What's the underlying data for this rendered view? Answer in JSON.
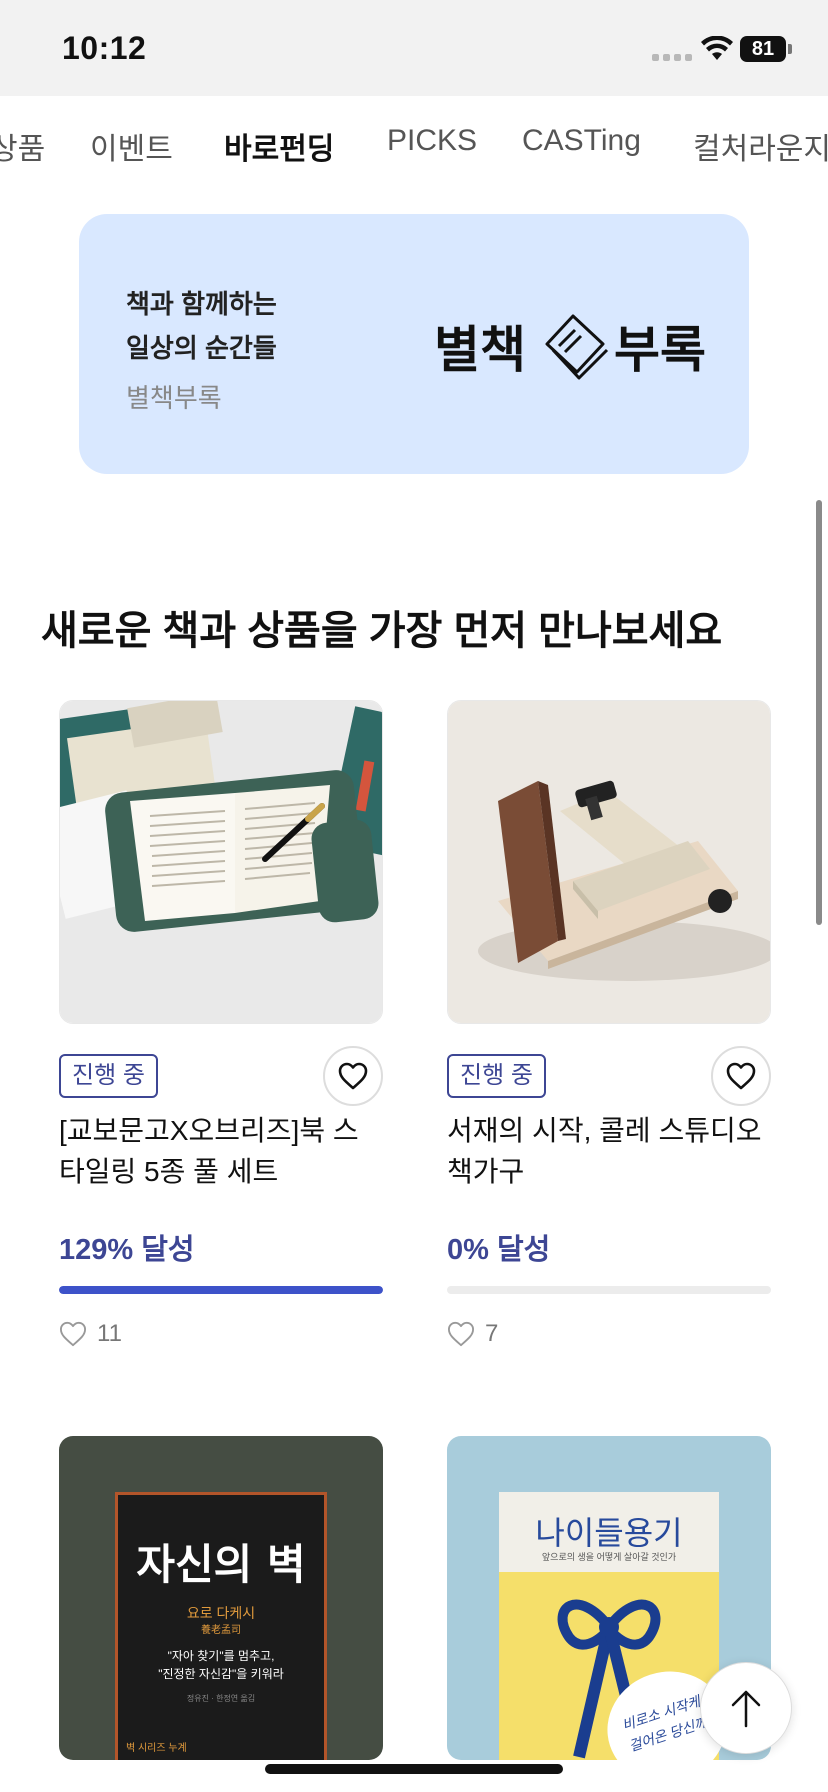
{
  "status_bar": {
    "time": "10:12",
    "battery": "81"
  },
  "tabs": [
    {
      "label": "상품"
    },
    {
      "label": "이벤트"
    },
    {
      "label": "바로펀딩"
    },
    {
      "label": "PICKS"
    },
    {
      "label": "CASTing"
    },
    {
      "label": "컬처라운지"
    }
  ],
  "banner": {
    "line1": "책과 함께하는",
    "line2": "일상의 순간들",
    "line3": "별책부록",
    "logo_a": "별책",
    "logo_b": "부록"
  },
  "section": {
    "title": "새로운 책과 상품을 가장 먼저 만나보세요"
  },
  "products": [
    {
      "badge": "진행 중",
      "title": "[교보문고X오브리즈]북 스타일링 5종 풀 세트",
      "achieve": "129% 달성",
      "progress_fraction": 1.0,
      "likes": "11"
    },
    {
      "badge": "진행 중",
      "title": "서재의 시작, 콜레 스튜디오 책가구",
      "achieve": "0% 달성",
      "progress_fraction": 0.0,
      "likes": "7"
    }
  ],
  "books": [
    {
      "title": "자신의 벽",
      "author": "요로 다케시",
      "author_sub": "養老孟司",
      "tagline1": "\"자아 찾기\"를 멈추고,",
      "tagline2": "\"진정한 자신감\"을 키워라",
      "translator": "정유진 · 한정연 옮김",
      "series": "벽 시리즈 누계"
    },
    {
      "title": "나이들용기",
      "subtitle": "앞으로의 생을 어떻게 살아갈 것인가",
      "tag1": "비로소 시작케",
      "tag2": "걸어온 당신께"
    }
  ],
  "colors": {
    "accent": "#3d4694",
    "progress": "#3d52c9",
    "banner_bg": "#d9e8ff"
  },
  "icons": [
    "wifi-icon",
    "heart-icon",
    "heart-outline-icon",
    "arrow-up-icon",
    "book-icon"
  ]
}
